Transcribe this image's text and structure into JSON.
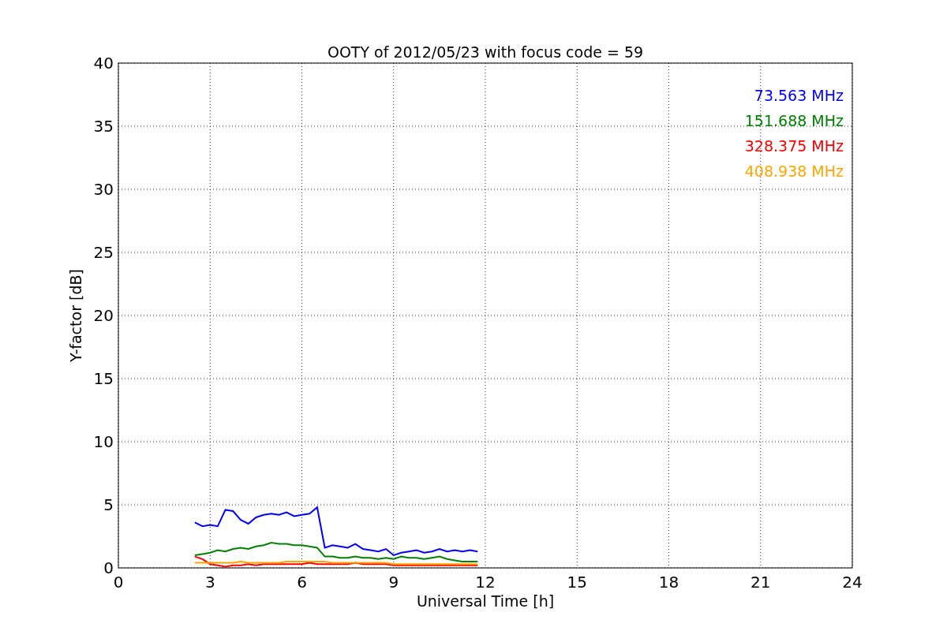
{
  "chart_data": {
    "type": "line",
    "title": "OOTY of 2012/05/23 with focus code = 59",
    "xlabel": "Universal Time [h]",
    "ylabel": "Y-factor [dB]",
    "x": [
      2.5,
      2.75,
      3,
      3.25,
      3.5,
      3.75,
      4,
      4.25,
      4.5,
      4.75,
      5,
      5.25,
      5.5,
      5.75,
      6,
      6.25,
      6.5,
      6.75,
      7,
      7.25,
      7.5,
      7.75,
      8,
      8.25,
      8.5,
      8.75,
      9,
      9.25,
      9.5,
      9.75,
      10,
      10.25,
      10.5,
      10.75,
      11,
      11.25,
      11.5,
      11.75
    ],
    "series": [
      {
        "name": "73.563 MHz",
        "color": "#0000ff",
        "values": [
          3.6,
          3.3,
          3.4,
          3.3,
          4.6,
          4.5,
          3.8,
          3.5,
          4.0,
          4.2,
          4.3,
          4.2,
          4.4,
          4.1,
          4.2,
          4.3,
          4.8,
          1.6,
          1.8,
          1.7,
          1.6,
          1.9,
          1.5,
          1.4,
          1.3,
          1.5,
          1.0,
          1.2,
          1.3,
          1.4,
          1.2,
          1.3,
          1.5,
          1.3,
          1.4,
          1.3,
          1.4,
          1.3
        ]
      },
      {
        "name": "151.688 MHz",
        "color": "#008000",
        "values": [
          1.0,
          1.1,
          1.2,
          1.4,
          1.3,
          1.5,
          1.6,
          1.5,
          1.7,
          1.8,
          2.0,
          1.9,
          1.9,
          1.8,
          1.8,
          1.7,
          1.6,
          0.9,
          0.9,
          0.8,
          0.8,
          0.9,
          0.8,
          0.8,
          0.7,
          0.8,
          0.7,
          0.9,
          0.8,
          0.8,
          0.7,
          0.8,
          0.9,
          0.7,
          0.6,
          0.5,
          0.5,
          0.5
        ]
      },
      {
        "name": "328.375 MHz",
        "color": "#ff0000",
        "values": [
          0.9,
          0.7,
          0.3,
          0.2,
          0.1,
          0.2,
          0.2,
          0.3,
          0.2,
          0.3,
          0.3,
          0.3,
          0.3,
          0.3,
          0.3,
          0.4,
          0.3,
          0.3,
          0.3,
          0.3,
          0.3,
          0.4,
          0.3,
          0.3,
          0.3,
          0.3,
          0.2,
          0.2,
          0.2,
          0.2,
          0.2,
          0.2,
          0.2,
          0.2,
          0.2,
          0.2,
          0.2,
          0.2
        ]
      },
      {
        "name": "408.938 MHz",
        "color": "#ffa500",
        "values": [
          0.4,
          0.4,
          0.4,
          0.4,
          0.4,
          0.4,
          0.5,
          0.4,
          0.4,
          0.4,
          0.4,
          0.4,
          0.5,
          0.5,
          0.5,
          0.5,
          0.5,
          0.5,
          0.4,
          0.4,
          0.4,
          0.4,
          0.4,
          0.4,
          0.4,
          0.4,
          0.3,
          0.3,
          0.3,
          0.3,
          0.3,
          0.3,
          0.3,
          0.3,
          0.3,
          0.3,
          0.3,
          0.3
        ]
      }
    ],
    "xlim": [
      0,
      24
    ],
    "ylim": [
      0,
      40
    ],
    "xticks": [
      0,
      3,
      6,
      9,
      12,
      15,
      18,
      21,
      24
    ],
    "yticks": [
      0,
      5,
      10,
      15,
      20,
      25,
      30,
      35,
      40
    ],
    "grid": true
  }
}
